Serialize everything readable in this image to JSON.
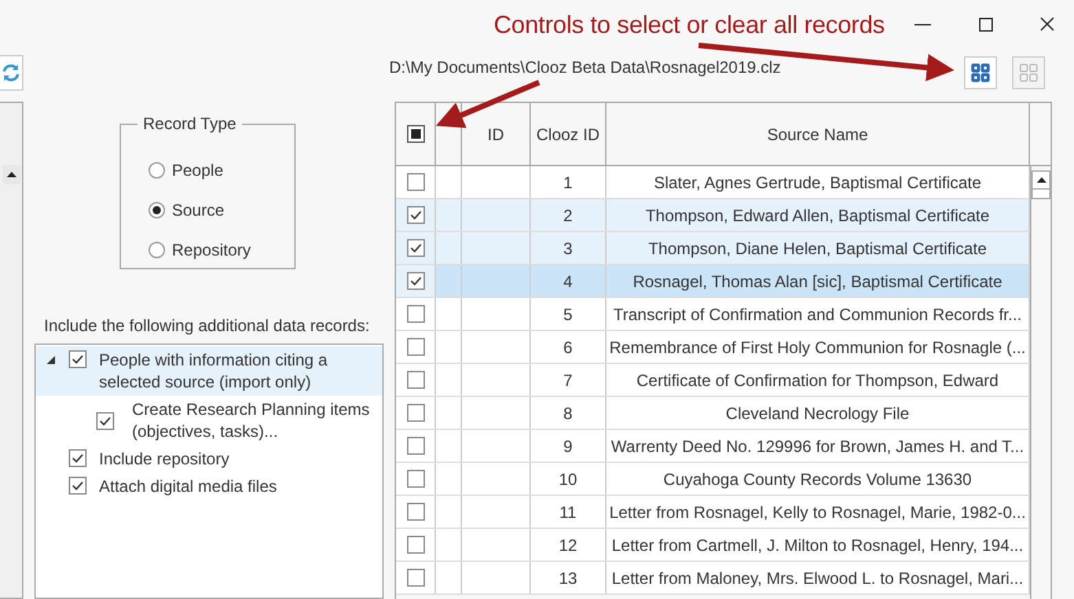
{
  "annotation": {
    "text": "Controls to select or clear all records"
  },
  "file_path": "D:\\My Documents\\Clooz Beta Data\\Rosnagel2019.clz",
  "toolbar": [
    {
      "kind": "select_all",
      "disabled": false
    },
    {
      "kind": "clear_all",
      "disabled": true
    }
  ],
  "record_type": {
    "title": "Record Type",
    "options": [
      {
        "label": "People",
        "selected": false
      },
      {
        "label": "Source",
        "selected": true
      },
      {
        "label": "Repository",
        "selected": false
      }
    ]
  },
  "additional": {
    "label": "Include the following additional data records:",
    "items": [
      {
        "label": "People with information citing a selected source (import only)",
        "checked": true,
        "expanded": true,
        "selected": true,
        "children": [
          {
            "label": "Create Research Planning items (objectives, tasks)...",
            "checked": true,
            "selected": false
          }
        ]
      },
      {
        "label": "Include repository",
        "checked": true,
        "selected": false
      },
      {
        "label": "Attach digital media files",
        "checked": true,
        "selected": false
      }
    ]
  },
  "table": {
    "header_checkbox": {
      "mixed": true
    },
    "columns": [
      "ID",
      "Clooz ID",
      "Source Name"
    ],
    "rows": [
      {
        "checked": false,
        "selected": false,
        "id": "",
        "clooz_id": "1",
        "source_name": "Slater, Agnes Gertrude, Baptismal Certificate"
      },
      {
        "checked": true,
        "selected": false,
        "id": "",
        "clooz_id": "2",
        "source_name": "Thompson, Edward Allen, Baptismal Certificate"
      },
      {
        "checked": true,
        "selected": false,
        "id": "",
        "clooz_id": "3",
        "source_name": "Thompson, Diane Helen, Baptismal Certificate"
      },
      {
        "checked": true,
        "selected": true,
        "id": "",
        "clooz_id": "4",
        "source_name": "Rosnagel, Thomas Alan [sic], Baptismal Certificate"
      },
      {
        "checked": false,
        "selected": false,
        "id": "",
        "clooz_id": "5",
        "source_name": "Transcript of Confirmation and Communion Records fr..."
      },
      {
        "checked": false,
        "selected": false,
        "id": "",
        "clooz_id": "6",
        "source_name": "Remembrance of First Holy Communion for Rosnagle (..."
      },
      {
        "checked": false,
        "selected": false,
        "id": "",
        "clooz_id": "7",
        "source_name": "Certificate of Confirmation for Thompson, Edward"
      },
      {
        "checked": false,
        "selected": false,
        "id": "",
        "clooz_id": "8",
        "source_name": "Cleveland Necrology File"
      },
      {
        "checked": false,
        "selected": false,
        "id": "",
        "clooz_id": "9",
        "source_name": "Warrenty Deed No. 129996 for Brown, James H. and T..."
      },
      {
        "checked": false,
        "selected": false,
        "id": "",
        "clooz_id": "10",
        "source_name": "Cuyahoga County Records Volume 13630"
      },
      {
        "checked": false,
        "selected": false,
        "id": "",
        "clooz_id": "11",
        "source_name": "Letter from Rosnagel, Kelly to Rosnagel, Marie, 1982-0..."
      },
      {
        "checked": false,
        "selected": false,
        "id": "",
        "clooz_id": "12",
        "source_name": "Letter from Cartmell, J. Milton to Rosnagel, Henry, 194..."
      },
      {
        "checked": false,
        "selected": false,
        "id": "",
        "clooz_id": "13",
        "source_name": "Letter from Maloney, Mrs. Elwood L. to Rosnagel, Mari..."
      }
    ]
  }
}
